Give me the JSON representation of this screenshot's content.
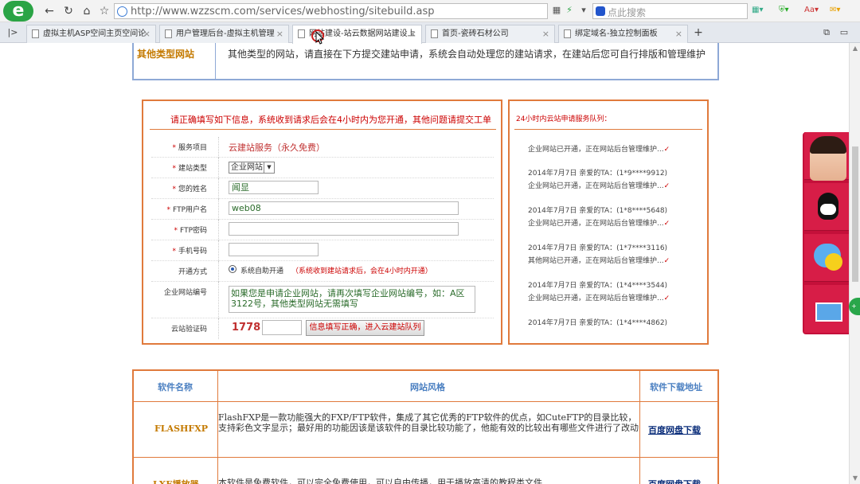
{
  "browser": {
    "url": "http://www.wzzscm.com/services/webhosting/sitebuild.asp",
    "search_placeholder": "点此搜索",
    "tabs": [
      {
        "label": "虚拟主机ASP空间主页空间论"
      },
      {
        "label": "用户管理后台-虚拟主机管理"
      },
      {
        "label": "网站建设-站云数据网站建设上"
      },
      {
        "label": "首页-瓷砖石材公司"
      },
      {
        "label": "绑定域名-独立控制面板"
      }
    ]
  },
  "top_table": {
    "label": "其他类型网站",
    "text": "其他类型的网站，请直接在下方提交建站申请，系统会自动处理您的建站请求，在建站后您可自行排版和管理维护"
  },
  "form": {
    "header": "请正确填写如下信息，系统收到请求后会在4小时内为您开通，其他问题请提交工单",
    "service_label": "服务项目",
    "service_value": "云建站服务（永久免费）",
    "type_label": "建站类型",
    "type_value": "企业网站",
    "name_label": "您的姓名",
    "name_value": "闻显",
    "ftp_user_label": "FTP用户名",
    "ftp_user_value": "web08",
    "ftp_pass_label": "FTP密码",
    "phone_label": "手机号码",
    "open_label": "开通方式",
    "open_option": "系统自助开通",
    "open_note": "（系统收到建站请求后，会在4小时内开通）",
    "code_label": "企业网站编号",
    "code_text": "如果您是申请企业网站，请再次填写企业网站编号，如：A区3122号，其他类型网站无需填写",
    "captcha_label": "云站验证码",
    "captcha_value": "1778",
    "submit_label": "信息填写正确，进入云建站队列"
  },
  "queue": {
    "header": "24小时内云站申请服务队列：",
    "items": [
      {
        "date": "",
        "status": "企业网站已开通，正在网站后台管理维护..."
      },
      {
        "date": "2014年7月7日 亲爱的TA：(1*9****9912)",
        "status": "企业网站已开通，正在网站后台管理维护..."
      },
      {
        "date": "2014年7月7日 亲爱的TA：(1*8****5648)",
        "status": "企业网站已开通，正在网站后台管理维护..."
      },
      {
        "date": "2014年7月7日 亲爱的TA：(1*7****3116)",
        "status": "其他网站已开通，正在网站后台管理维护..."
      },
      {
        "date": "2014年7月7日 亲爱的TA：(1*4****3544)",
        "status": "企业网站已开通，正在网站后台管理维护..."
      },
      {
        "date": "2014年7月7日 亲爱的TA：(1*4****4862)",
        "status": ""
      }
    ]
  },
  "software": {
    "col1": "软件名称",
    "col2": "网站风格",
    "col3": "软件下载地址",
    "rows": [
      {
        "name": "FLASHFXP",
        "desc": "FlashFXP是一款功能强大的FXP/FTP软件，集成了其它优秀的FTP软件的优点，如CuteFTP的目录比较，支持彩色文字显示；最好用的功能因该是该软件的目录比较功能了，他能有效的比较出有哪些文件进行了改动",
        "link": "百度网盘下载"
      },
      {
        "name": "LXE播放器",
        "desc": "本软件是免费软件，可以完全免费使用，可以自由传播，用于播放高清的教程类文件",
        "link": "百度网盘下载"
      }
    ]
  },
  "icons": {
    "accent": "#e07a3c",
    "side_bg": "#c4103a"
  }
}
